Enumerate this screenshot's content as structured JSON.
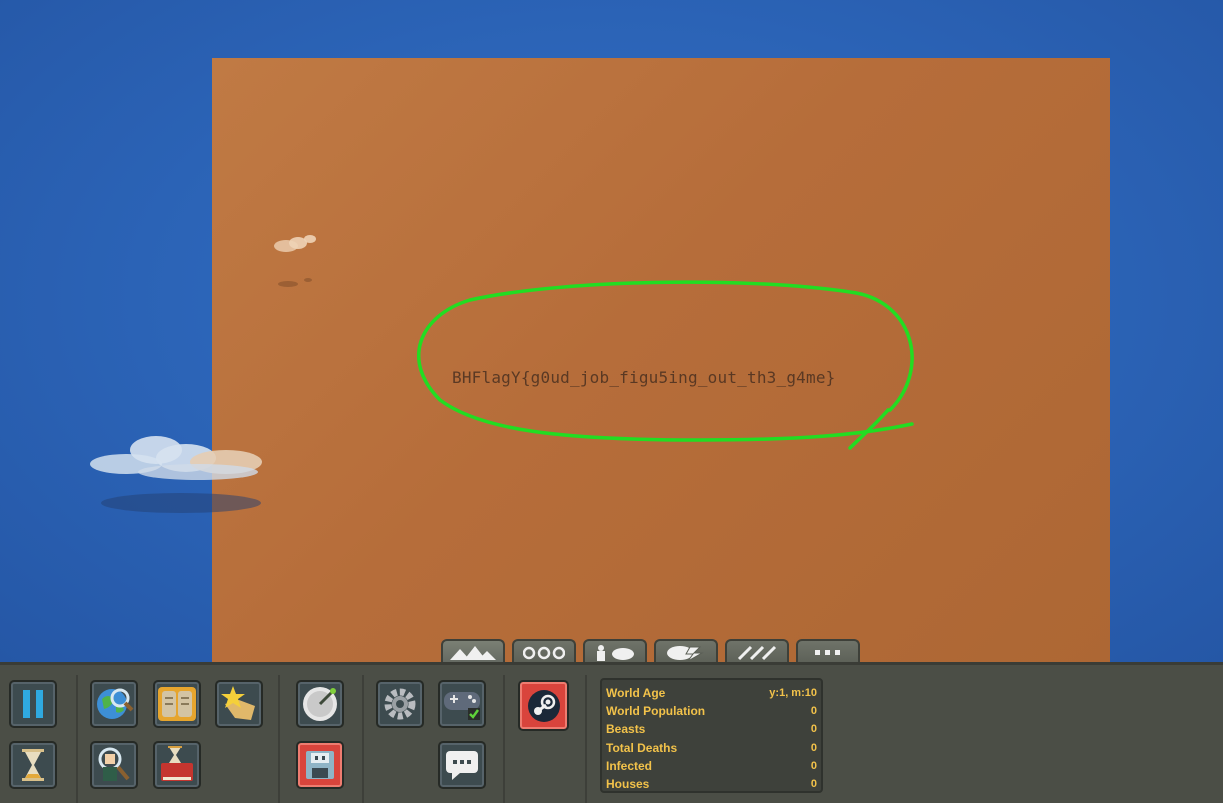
{
  "map": {
    "flag_text": "BHFlagY{g0ud_job_figu5ing_out_th3_g4me}"
  },
  "tabs": [
    {
      "icon": "mountains-icon",
      "glyph": "▲▲▲"
    },
    {
      "icon": "creatures-icon",
      "glyph": "ʘʘʘ"
    },
    {
      "icon": "units-icon",
      "glyph": "♟☁"
    },
    {
      "icon": "powers-icon",
      "glyph": "☁⚡"
    },
    {
      "icon": "tools-icon",
      "glyph": "⚔⚔"
    },
    {
      "icon": "more-icon",
      "glyph": "•••"
    }
  ],
  "colors": {
    "ocean": "#2b63b6",
    "land": "#b66d3a",
    "annotation": "#22dd22",
    "stats_text": "#f2c24a",
    "panel": "#4b4e46"
  },
  "stats": {
    "rows": [
      {
        "label": "World Age",
        "value": "y:1, m:10"
      },
      {
        "label": "World Population",
        "value": "0"
      },
      {
        "label": "Beasts",
        "value": "0"
      },
      {
        "label": "Total Deaths",
        "value": "0"
      },
      {
        "label": "Infected",
        "value": "0"
      },
      {
        "label": "Houses",
        "value": "0"
      }
    ]
  }
}
